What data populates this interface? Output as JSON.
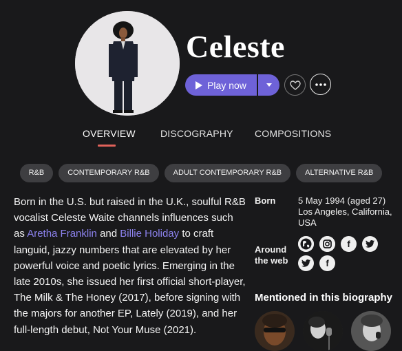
{
  "artist": {
    "name": "Celeste"
  },
  "actions": {
    "play_label": "Play now"
  },
  "tabs": [
    {
      "label": "OVERVIEW",
      "active": true
    },
    {
      "label": "DISCOGRAPHY",
      "active": false
    },
    {
      "label": "COMPOSITIONS",
      "active": false
    }
  ],
  "genres": [
    "R&B",
    "CONTEMPORARY R&B",
    "ADULT CONTEMPORARY R&B",
    "ALTERNATIVE R&B"
  ],
  "bio": {
    "part1": "Born in the U.S. but raised in the U.K., soulful R&B vocalist Celeste Waite channels influences such as ",
    "link1": "Aretha Franklin",
    "part2": " and ",
    "link2": "Billie Holiday",
    "part3": " to craft languid, jazzy numbers that are elevated by her powerful voice and poetic lyrics. Emerging in the late 2010s, she issued her first official short-player, The Milk & The Honey (2017), before signing with the majors for another EP, Lately (2019), and her full-length debut, Not Your Muse (2021)."
  },
  "info": {
    "born_label": "Born",
    "born_date": "5 May 1994 (aged 27)",
    "born_place": "Los Angeles, California, USA",
    "web_label": "Around the web",
    "social_icons": [
      "globe-icon",
      "instagram-icon",
      "facebook-icon",
      "twitter-icon",
      "twitter-icon",
      "facebook-icon"
    ]
  },
  "mentioned": {
    "title": "Mentioned in this biography"
  },
  "colors": {
    "background": "#19191b",
    "accent": "#6e62d8",
    "link": "#8c82ee",
    "tab_underline": "#e0625a",
    "pill": "#3e3e41"
  }
}
